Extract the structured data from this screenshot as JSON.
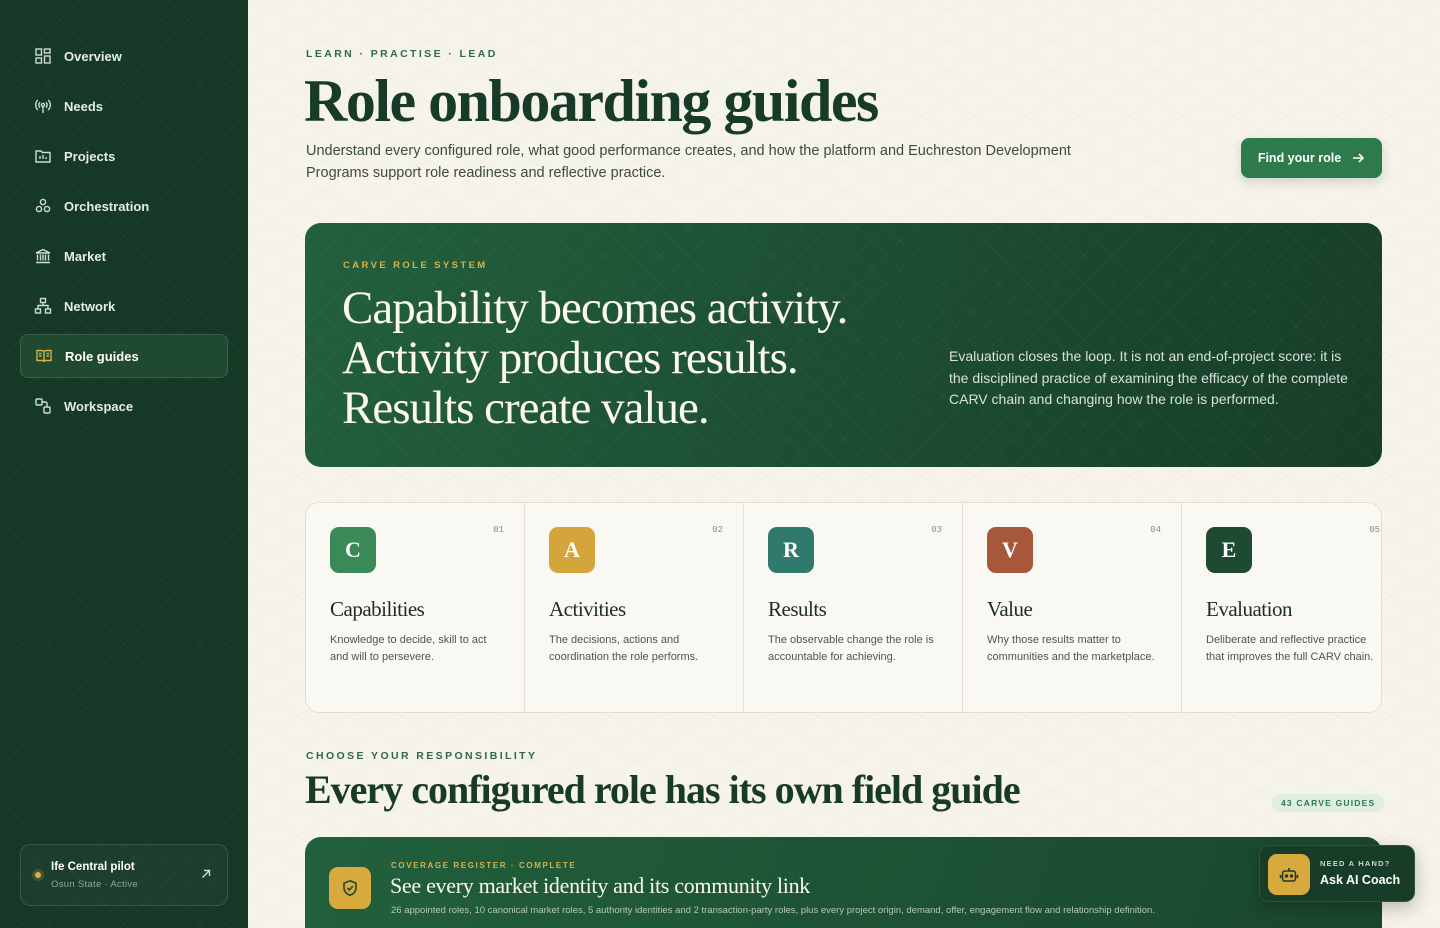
{
  "sidebar": {
    "items": [
      {
        "label": "Overview",
        "icon": "grid-icon"
      },
      {
        "label": "Needs",
        "icon": "broadcast-icon"
      },
      {
        "label": "Projects",
        "icon": "folder-chart-icon"
      },
      {
        "label": "Orchestration",
        "icon": "network-nodes-icon"
      },
      {
        "label": "Market",
        "icon": "bank-icon"
      },
      {
        "label": "Network",
        "icon": "hierarchy-icon"
      },
      {
        "label": "Role guides",
        "icon": "book-open-icon",
        "active": true
      },
      {
        "label": "Workspace",
        "icon": "shapes-icon"
      }
    ],
    "pilot": {
      "title": "Ife Central pilot",
      "subtitle": "Osun State · Active"
    }
  },
  "hero": {
    "eyebrow": "LEARN · PRACTISE · LEAD",
    "title": "Role onboarding guides",
    "description": "Understand every configured role, what good performance creates, and how the platform and Euchreston Development Programs support role readiness and reflective practice.",
    "cta_label": "Find your role"
  },
  "banner": {
    "eyebrow": "CARVE ROLE SYSTEM",
    "lines": [
      "Capability becomes activity.",
      "Activity produces results.",
      "Results create value."
    ],
    "side_text": "Evaluation closes the loop. It is not an end-of-project score: it is the disciplined practice of examining the efficacy of the complete CARV chain and changing how the role is performed."
  },
  "carv": [
    {
      "letter": "C",
      "num": "01",
      "title": "Capabilities",
      "desc": "Knowledge to decide, skill to act and will to persevere.",
      "color": "#3a8a58"
    },
    {
      "letter": "A",
      "num": "02",
      "title": "Activities",
      "desc": "The decisions, actions and coordination the role performs.",
      "color": "#d4a53a"
    },
    {
      "letter": "R",
      "num": "03",
      "title": "Results",
      "desc": "The observable change the role is accountable for achieving.",
      "color": "#2f7a6c"
    },
    {
      "letter": "V",
      "num": "04",
      "title": "Value",
      "desc": "Why those results matter to communities and the marketplace.",
      "color": "#a8583a"
    },
    {
      "letter": "E",
      "num": "05",
      "title": "Evaluation",
      "desc": "Deliberate and reflective practice that improves the full CARV chain.",
      "color": "#1d4a31"
    }
  ],
  "section": {
    "eyebrow": "CHOOSE YOUR RESPONSIBILITY",
    "title": "Every configured role has its own field guide",
    "pill": "43 CARVE GUIDES"
  },
  "coverage": {
    "eyebrow": "COVERAGE REGISTER · COMPLETE",
    "title": "See every market identity and its community link",
    "description": "26 appointed roles, 10 canonical market roles, 5 authority identities and 2 transaction-party roles, plus every project origin, demand, offer, engagement flow and relationship definition."
  },
  "coach": {
    "eyebrow": "NEED A HAND?",
    "title": "Ask AI Coach"
  }
}
